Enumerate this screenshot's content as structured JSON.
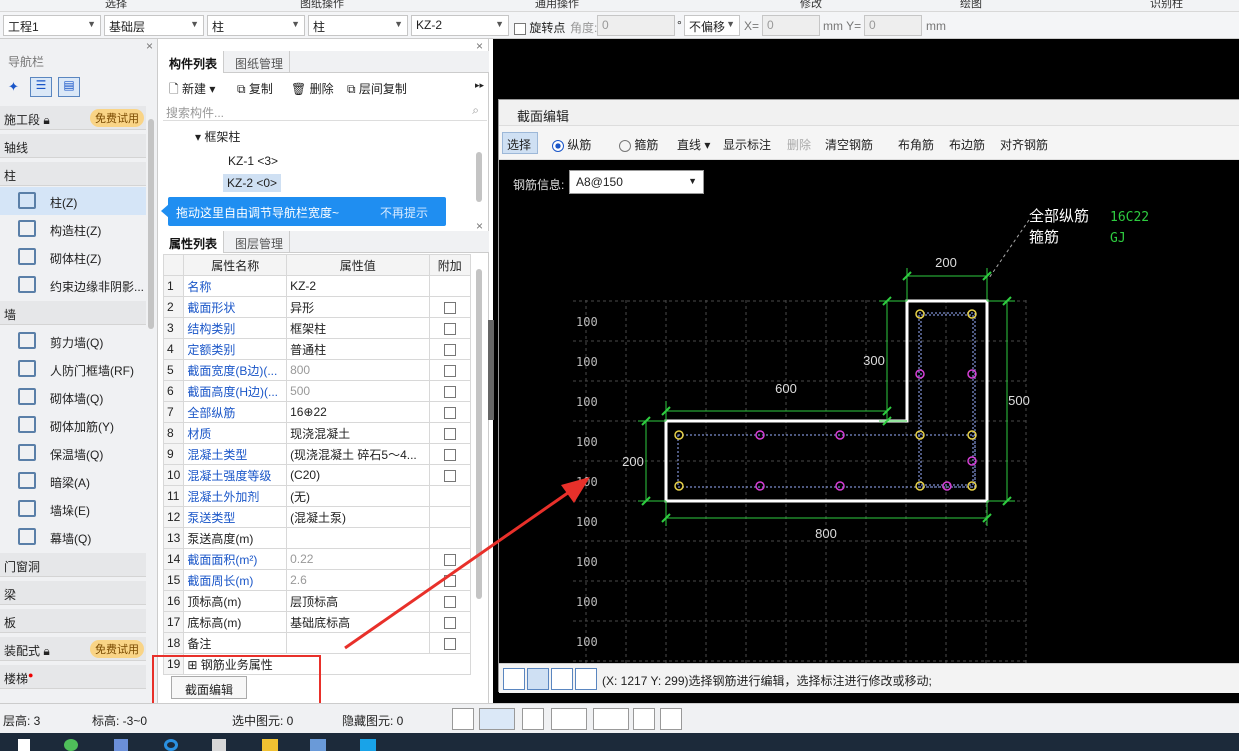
{
  "ribbon": [
    "选择",
    "图纸操作",
    "通用操作",
    "修改",
    "绘图",
    "识别柱"
  ],
  "selector": {
    "floor": "工程1",
    "layer": "基础层",
    "type1": "柱",
    "type2": "柱",
    "component": "KZ-2",
    "rotate_label": "旋转点",
    "angle_label": "角度:",
    "angle_value": "0",
    "degree": "°",
    "offset": "不偏移",
    "x_label": "X=",
    "x_value": "0",
    "mm_y": "mm Y=",
    "y_value": "0",
    "mm": "mm"
  },
  "nav": {
    "title": "导航栏",
    "categories": [
      {
        "label": "施工段",
        "badge": "免费试用"
      },
      {
        "label": "轴线"
      },
      {
        "label": "柱"
      },
      {
        "label": "墙"
      },
      {
        "label": "门窗洞"
      },
      {
        "label": "梁"
      },
      {
        "label": "板"
      },
      {
        "label": "装配式",
        "badge": "免费试用"
      },
      {
        "label": "楼梯"
      }
    ],
    "column_items": [
      "柱(Z)",
      "构造柱(Z)",
      "砌体柱(Z)",
      "约束边缘非阴影..."
    ],
    "wall_items": [
      "剪力墙(Q)",
      "人防门框墙(RF)",
      "砌体墙(Q)",
      "砌体加筋(Y)",
      "保温墙(Q)",
      "暗梁(A)",
      "墙垛(E)",
      "幕墙(Q)"
    ]
  },
  "tooltip": {
    "text": "拖动这里自由调节导航栏宽度~",
    "dismiss": "不再提示"
  },
  "component_panel": {
    "tabs": [
      "构件列表",
      "图纸管理"
    ],
    "toolbar": [
      "新建",
      "复制",
      "删除",
      "层间复制"
    ],
    "search_placeholder": "搜索构件...",
    "tree_root": "框架柱",
    "items": [
      "KZ-1  <3>",
      "KZ-2  <0>"
    ]
  },
  "property_panel": {
    "tabs": [
      "属性列表",
      "图层管理"
    ],
    "headers": [
      "属性名称",
      "属性值",
      "附加"
    ],
    "rows": [
      {
        "n": "1",
        "k": "名称",
        "v": "KZ-2",
        "blue": true,
        "cb": false
      },
      {
        "n": "2",
        "k": "截面形状",
        "v": "异形",
        "blue": true,
        "cb": true
      },
      {
        "n": "3",
        "k": "结构类别",
        "v": "框架柱",
        "blue": true,
        "cb": true
      },
      {
        "n": "4",
        "k": "定额类别",
        "v": "普通柱",
        "blue": true,
        "cb": true
      },
      {
        "n": "5",
        "k": "截面宽度(B边)(...",
        "v": "800",
        "blue": true,
        "cb": true,
        "grey": true
      },
      {
        "n": "6",
        "k": "截面高度(H边)(...",
        "v": "500",
        "blue": true,
        "cb": true,
        "grey": true
      },
      {
        "n": "7",
        "k": "全部纵筋",
        "v": "16⊕22",
        "blue": true,
        "cb": true
      },
      {
        "n": "8",
        "k": "材质",
        "v": "现浇混凝土",
        "blue": true,
        "cb": true
      },
      {
        "n": "9",
        "k": "混凝土类型",
        "v": "(现浇混凝土   碎石5～4...",
        "blue": true,
        "cb": true
      },
      {
        "n": "10",
        "k": "混凝土强度等级",
        "v": "(C20)",
        "blue": true,
        "cb": true
      },
      {
        "n": "11",
        "k": "混凝土外加剂",
        "v": "(无)",
        "blue": true,
        "cb": false
      },
      {
        "n": "12",
        "k": "泵送类型",
        "v": "(混凝土泵)",
        "blue": true,
        "cb": false
      },
      {
        "n": "13",
        "k": "泵送高度(m)",
        "v": "",
        "blue": false,
        "cb": false
      },
      {
        "n": "14",
        "k": "截面面积(m²)",
        "v": "0.22",
        "blue": true,
        "cb": true,
        "grey": true
      },
      {
        "n": "15",
        "k": "截面周长(m)",
        "v": "2.6",
        "blue": true,
        "cb": true,
        "grey": true
      },
      {
        "n": "16",
        "k": "顶标高(m)",
        "v": "层顶标高",
        "blue": false,
        "cb": true
      },
      {
        "n": "17",
        "k": "底标高(m)",
        "v": "基础底标高",
        "blue": false,
        "cb": true
      },
      {
        "n": "18",
        "k": "备注",
        "v": "",
        "blue": false,
        "cb": true
      },
      {
        "n": "19",
        "k": "钢筋业务属性",
        "v": "",
        "blue": false,
        "cb": false
      }
    ],
    "section_edit_button": "截面编辑"
  },
  "dialog": {
    "title": "截面编辑",
    "toolbar": {
      "select": "选择",
      "longitudinal": "纵筋",
      "stirrup": "箍筋",
      "line": "直线",
      "show_dim": "显示标注",
      "delete": "删除",
      "clear": "清空钢筋",
      "corner": "布角筋",
      "edge": "布边筋",
      "align": "对齐钢筋"
    },
    "rebar_info_label": "钢筋信息:",
    "rebar_info_value": "A8@150",
    "legend": {
      "all_label": "全部纵筋",
      "all_value": "16C22",
      "stirrup_label": "箍筋",
      "stirrup_value": "GJ"
    },
    "dims": {
      "top": "200",
      "v300": "300",
      "h600": "600",
      "right500": "500",
      "left200": "200",
      "bottom800": "800"
    },
    "grid_label": "100",
    "status": "(X: 1217 Y: 299)选择钢筋进行编辑，选择标注进行修改或移动;"
  },
  "statusbar": {
    "floor_height": "层高:  3",
    "elevation": "标高:  -3~0",
    "selected": "选中图元:  0",
    "hidden": "隐藏图元:  0"
  },
  "colors": {
    "accent": "#1f8ef1",
    "link": "#1a56c8",
    "badge": "#f9d486",
    "dim_green": "#2ecc40",
    "rebar_yellow": "#e8d24a",
    "rebar_magenta": "#d63fd6",
    "arrow_red": "#e8302a"
  }
}
